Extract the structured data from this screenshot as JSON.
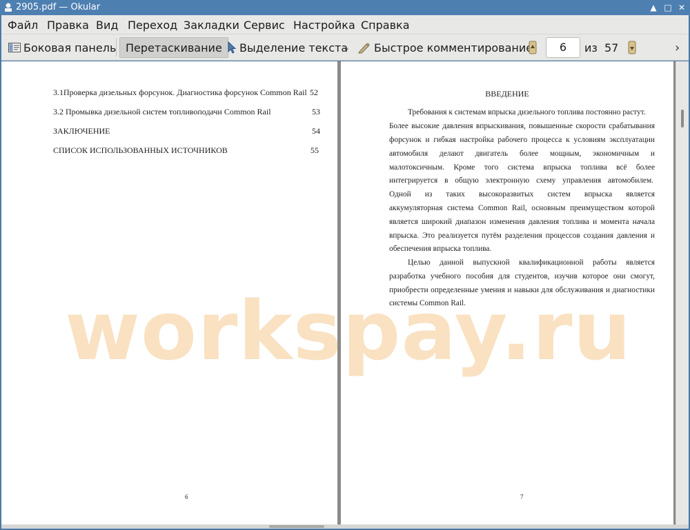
{
  "window": {
    "title": "2905.pdf  — Okular",
    "controls": [
      "▲",
      "□",
      "✕"
    ]
  },
  "menu": [
    "Файл",
    "Правка",
    "Вид",
    "Переход",
    "Закладки",
    "Сервис",
    "Настройка",
    "Справка"
  ],
  "toolbar": {
    "sidebar": "Боковая панель",
    "browse": "Перетаскивание",
    "text_select": "Выделение текста",
    "annotate": "Быстрое комментирование",
    "current_page": "6",
    "of": "из",
    "total_pages": "57",
    "overflow": "›"
  },
  "left_page": {
    "toc": [
      {
        "text": "3.1Проверка дизельных форсунок. Диагностика форсунок Common Rail",
        "page": "52"
      },
      {
        "text": "3.2 Промывка дизельной систем топливоподачи Common Rail",
        "page": "53"
      },
      {
        "text": "ЗАКЛЮЧЕНИЕ",
        "page": "54"
      },
      {
        "text": "СПИСОК ИСПОЛЬЗОВАННЫХ ИСТОЧНИКОВ",
        "page": "55"
      }
    ],
    "number": "6"
  },
  "right_page": {
    "heading": "ВВЕДЕНИЕ",
    "lines": [
      "Требования к системам впрыска дизельного топлива постоянно растут.",
      "Более высокие давления впрыскивания, повышенные скорости срабатывания",
      "форсунок и гибкая настройка рабочего процесса к условиям эксплуатации",
      "автомобиля делают двигатель более мощным, экономичным и",
      "малотоксичным. Кроме того система впрыска топлива всё более",
      "интегрируется в общую электронную схему управления автомобилем.",
      "Одной из таких высокоразвитых систем впрыска является",
      "аккумуляторная система Common Rail, основным преимуществом которой",
      "является широкий диапазон изменения давления топлива и момента начала",
      "впрыска. Это реализуется путём разделения процессов создания давления и",
      "обеспечения впрыска топлива.",
      "Целью данной выпускной квалификационной работы является",
      "разработка учебного пособия для студентов, изучив которое они смогут,",
      "приобрести определенные умения и навыки для обслуживания и диагностики",
      "системы Common Rail."
    ],
    "number": "7"
  },
  "watermark": "workspay.ru"
}
